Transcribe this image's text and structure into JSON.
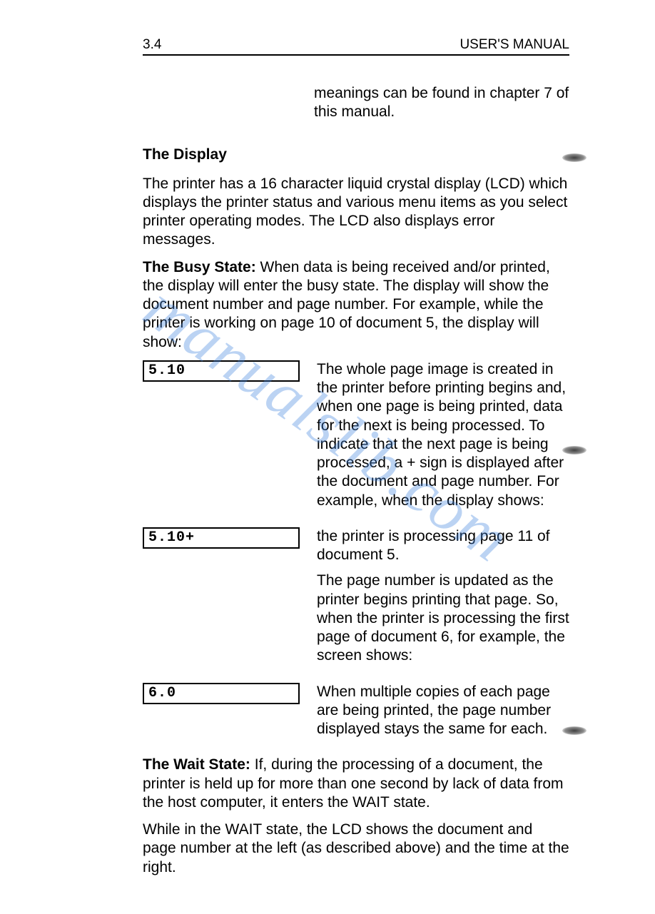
{
  "header": {
    "left": "3.4",
    "right": "USER'S MANUAL"
  },
  "top_fragment": "meanings can be found in chapter 7 of this manual.",
  "section_heading": "The Display",
  "intro_para": "The printer has a 16 character liquid crystal display (LCD) which displays the printer status and various menu items as you select printer operating modes. The LCD also displays error messages.",
  "busy_state": {
    "lead": "The Busy State:",
    "text": " When data is being received and/or printed, the display will enter the busy state. The display will show the document number and page number. For example, while the printer is working on page 10 of document 5, the display will show:"
  },
  "rows": [
    {
      "lcd": "5.10",
      "paras": [
        "The whole page image is created in the printer before printing begins and, when one page is being printed, data for the next is being processed. To indicate that the next page is being processed, a + sign is displayed after the document and page number. For example, when the display shows:"
      ]
    },
    {
      "lcd": "5.10+",
      "paras": [
        "the printer is processing page 11 of document 5.",
        "The page number is updated as the printer begins printing that page. So, when the printer is processing the first page of document 6, for example, the screen shows:"
      ]
    },
    {
      "lcd": "6.0",
      "paras": [
        "When multiple copies of each page are being printed, the page number displayed stays the same for each."
      ]
    }
  ],
  "wait_state": {
    "lead": "The Wait State:",
    "text": " If, during the processing of a document, the printer is held up for more than one second by lack of data from the host computer, it enters the WAIT state."
  },
  "wait_para2": "While in the WAIT state, the LCD shows the document and page number at the left (as described above) and the time at the right.",
  "watermark": "manualslib.com"
}
